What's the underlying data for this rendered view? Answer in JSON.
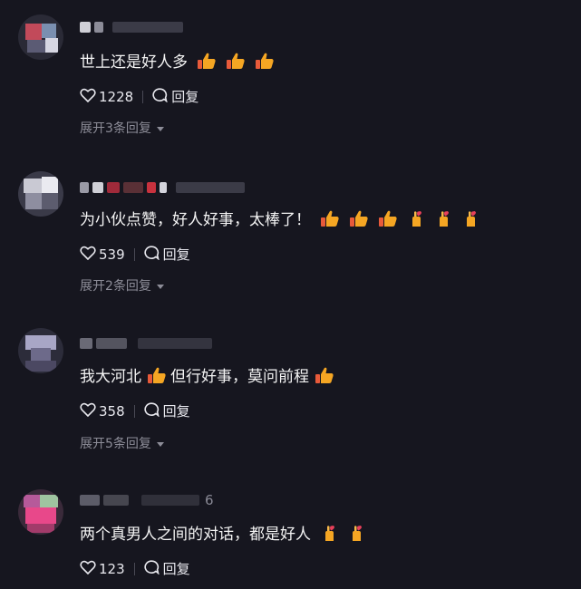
{
  "comments": [
    {
      "text": "世上还是好人多",
      "emojis": [
        "thumbs-up-icon",
        "thumbs-up-icon",
        "thumbs-up-icon"
      ],
      "likes": "1228",
      "reply_label": "回复",
      "expand_label": "展开3条回复",
      "name_suffix": ""
    },
    {
      "text": "为小伙点赞，好人好事，太棒了！",
      "emojis": [
        "thumbs-up-icon",
        "thumbs-up-icon",
        "thumbs-up-icon",
        "finger-heart-icon",
        "finger-heart-icon",
        "finger-heart-icon"
      ],
      "likes": "539",
      "reply_label": "回复",
      "expand_label": "展开2条回复",
      "name_suffix": ""
    },
    {
      "text": "我大河北",
      "text_after_emoji": "但行好事，莫问前程",
      "emojis": [
        "thumbs-up-icon",
        "thumbs-up-icon"
      ],
      "likes": "358",
      "reply_label": "回复",
      "expand_label": "展开5条回复",
      "name_suffix": ""
    },
    {
      "text": "两个真男人之间的对话，都是好人",
      "emojis": [
        "finger-heart-icon",
        "finger-heart-icon"
      ],
      "likes": "123",
      "reply_label": "回复",
      "expand_label": "",
      "name_suffix": "6"
    }
  ],
  "colors": {
    "background": "#16161f",
    "primary_text": "#f4f4f4",
    "secondary_text": "#8d8d98",
    "thumbs_up": "#f5a623",
    "heart": "#e8405a"
  }
}
